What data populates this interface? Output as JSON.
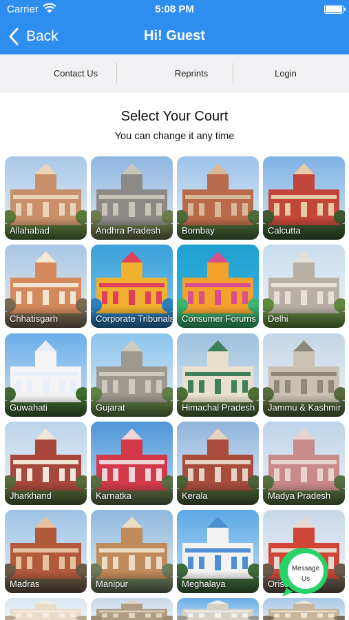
{
  "status": {
    "carrier": "Carrier",
    "time": "5:08 PM"
  },
  "nav": {
    "back_label": "Back",
    "title": "Hi! Guest"
  },
  "tabs": [
    {
      "label": "Contact Us"
    },
    {
      "label": "Reprints"
    },
    {
      "label": "Login"
    }
  ],
  "main": {
    "heading": "Select Your Court",
    "subheading": "You can change it any time"
  },
  "courts": [
    {
      "name": "Allahabad"
    },
    {
      "name": "Andhra Pradesh"
    },
    {
      "name": "Bombay"
    },
    {
      "name": "Calcutta"
    },
    {
      "name": "Chhatisgarh"
    },
    {
      "name": "Corporate Tribunals"
    },
    {
      "name": "Consumer Forums"
    },
    {
      "name": "Delhi"
    },
    {
      "name": "Guwahati"
    },
    {
      "name": "Gujarat"
    },
    {
      "name": "Himachal Pradesh"
    },
    {
      "name": "Jammu & Kashmir"
    },
    {
      "name": "Jharkhand"
    },
    {
      "name": "Karnatka"
    },
    {
      "name": "Kerala"
    },
    {
      "name": "Madya Pradesh"
    },
    {
      "name": "Madras"
    },
    {
      "name": "Manipur"
    },
    {
      "name": "Meghalaya"
    },
    {
      "name": "Orissa"
    },
    {
      "name": ""
    },
    {
      "name": ""
    },
    {
      "name": ""
    },
    {
      "name": ""
    }
  ],
  "whatsapp": {
    "label_line1": "Message",
    "label_line2": "Us"
  },
  "colors": {
    "nav_bar": "#2e8ef0",
    "tab_bar": "#f1f1f3",
    "whatsapp_green": "#25d366"
  }
}
